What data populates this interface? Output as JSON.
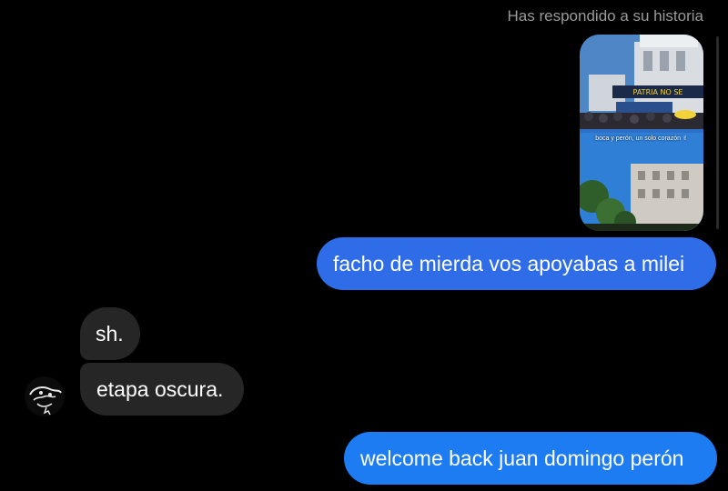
{
  "conversation": {
    "story_reply_label": "Has respondido a su historia",
    "story": {
      "caption": "boca y perón, un solo corazón ✌"
    },
    "messages": [
      {
        "direction": "outgoing",
        "text": "facho de mierda vos apoyabas a milei"
      },
      {
        "direction": "incoming",
        "text": "sh."
      },
      {
        "direction": "incoming",
        "text": "etapa oscura."
      },
      {
        "direction": "outgoing",
        "text": "welcome back juan domingo perón"
      }
    ]
  },
  "colors": {
    "background": "#000000",
    "outgoing_bubble": "#2f6de8",
    "outgoing_bubble_latest": "#1d7cf2",
    "incoming_bubble": "#262626",
    "meta_text": "#9a9a9a"
  }
}
